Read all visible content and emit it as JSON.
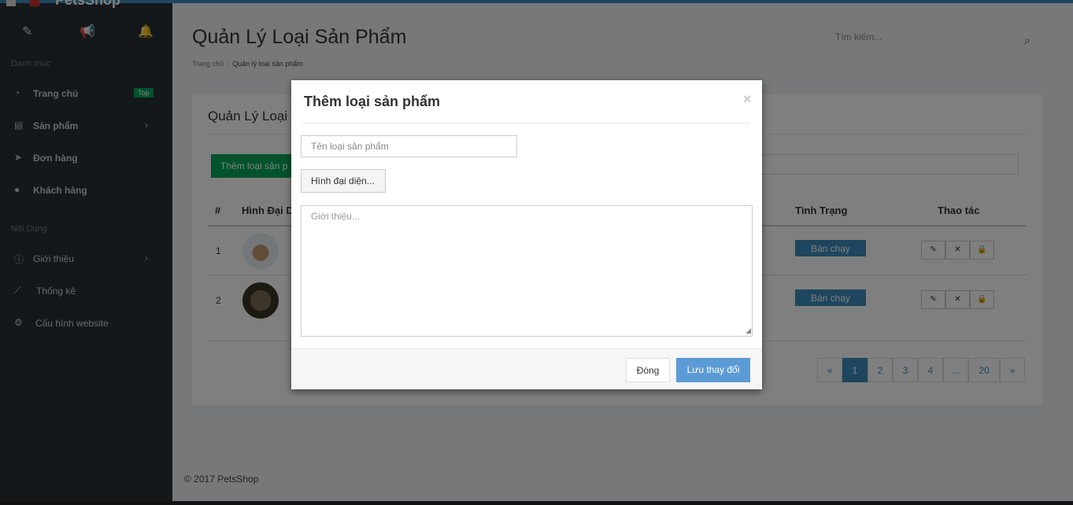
{
  "sidebar": {
    "brand": "PetsShop",
    "icons": [
      "wand-icon",
      "bullhorn-icon",
      "bell-icon"
    ],
    "section_catalog": "Danh mục",
    "section_content": "Nội Dung",
    "items": [
      {
        "label": "Trang chủ",
        "badge": "Top"
      },
      {
        "label": "Sản phẩm"
      },
      {
        "label": "Đơn hàng"
      },
      {
        "label": "Khách hàng"
      },
      {
        "label": "Giới thiệu"
      },
      {
        "label": "Thống kê"
      },
      {
        "label": "Cấu hình website"
      }
    ]
  },
  "header": {
    "title": "Quản Lý Loại Sản Phẩm",
    "breadcrumb": [
      "Trang chủ",
      "Quản lý loại sản phẩm"
    ],
    "search_placeholder": "Tìm kiếm..."
  },
  "main": {
    "box_title": "Quản Lý Loại",
    "add_button": "Thêm loại sản p",
    "columns": [
      "#",
      "Hình Đại D",
      "Tình Trạng",
      "Thao tác"
    ],
    "rows": [
      {
        "num": "1",
        "status": "Bán chạy"
      },
      {
        "num": "2",
        "status": "Bán chạy"
      }
    ],
    "pagination": [
      "«",
      "1",
      "2",
      "3",
      "4",
      "...",
      "20",
      "»"
    ],
    "active_page": "1"
  },
  "footer": "© 2017 PetsShop",
  "modal": {
    "title": "Thêm loại sản phẩm",
    "close_symbol": "×",
    "name_placeholder": "Tên loại sản phẩm",
    "file_button": "Hình đại diện...",
    "intro_placeholder": "Giới thiệu...",
    "cancel_button": "Đóng",
    "save_button": "Lưu thay đổi"
  },
  "colors": {
    "sidebar_bg": "#2b3135",
    "accent": "#3c8dbc",
    "success": "#00a65a",
    "save_button": "#5b9bd5"
  }
}
